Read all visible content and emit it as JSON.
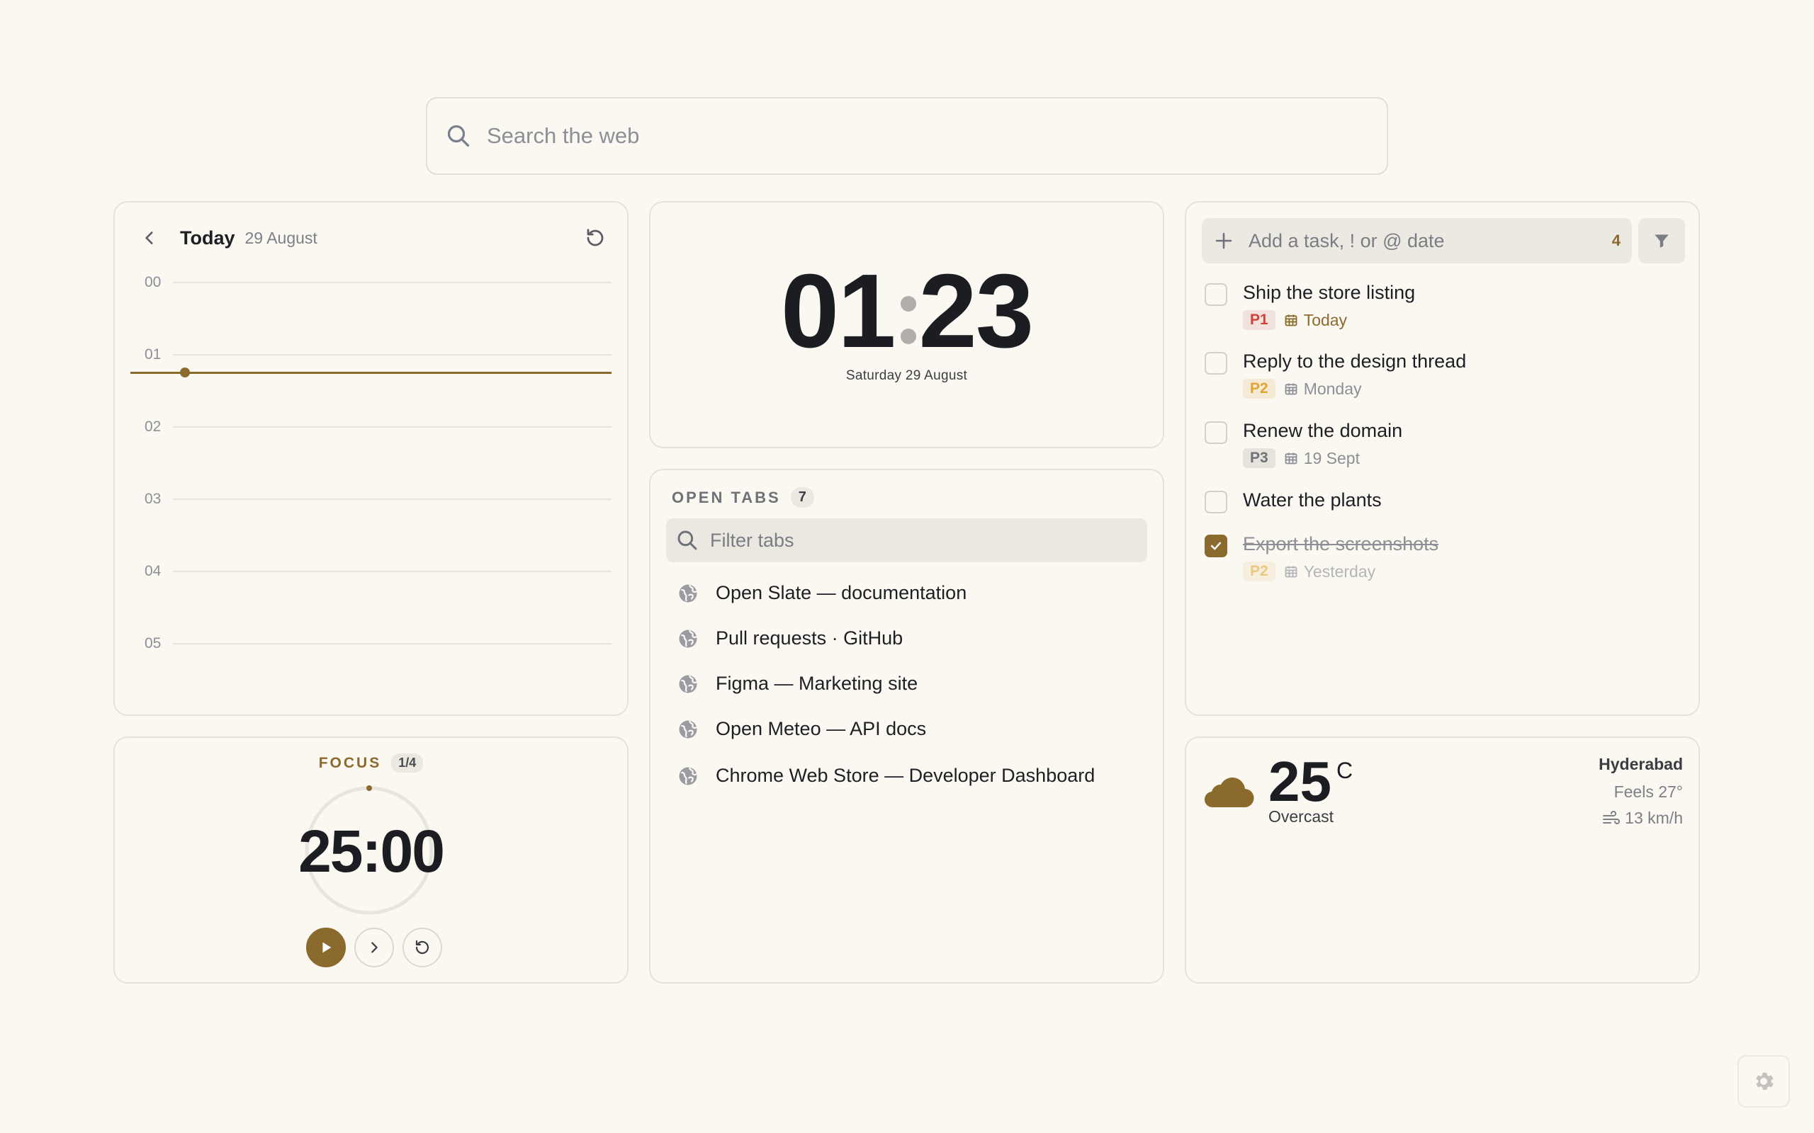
{
  "search": {
    "placeholder": "Search the web"
  },
  "calendar": {
    "title": "Today",
    "date": "29 August",
    "hours": [
      "00",
      "01",
      "02",
      "03",
      "04",
      "05"
    ]
  },
  "clock": {
    "hours": "01",
    "minutes": "23",
    "date": "Saturday 29 August"
  },
  "tasks": {
    "add_placeholder": "Add a task, ! or @ date",
    "count": "4",
    "items": [
      {
        "title": "Ship the store listing",
        "priority": "P1",
        "due": "Today",
        "done": false
      },
      {
        "title": "Reply to the design thread",
        "priority": "P2",
        "due": "Monday",
        "done": false
      },
      {
        "title": "Renew the domain",
        "priority": "P3",
        "due": "19 Sept",
        "done": false
      },
      {
        "title": "Water the plants",
        "priority": "",
        "due": "",
        "done": false
      },
      {
        "title": "Export the screenshots",
        "priority": "P2",
        "due": "Yesterday",
        "done": true
      }
    ]
  },
  "focus": {
    "label": "FOCUS",
    "session": "1/4",
    "time": "25:00",
    "progress": 0
  },
  "tabs": {
    "label": "OPEN TABS",
    "count": "7",
    "filter_placeholder": "Filter tabs",
    "items": [
      "Open Slate — documentation",
      "Pull requests · GitHub",
      "Figma — Marketing site",
      "Open Meteo — API docs",
      "Chrome Web Store — Developer Dashboard"
    ]
  },
  "weather": {
    "temp": "25",
    "unit": "C",
    "condition": "Overcast",
    "city": "Hyderabad",
    "feels": "Feels 27°",
    "wind": "13 km/h"
  },
  "colors": {
    "accent": "#8b6a2e",
    "background": "#fbf8f2",
    "p1": "#d1403c",
    "p2": "#e3a42e",
    "p3": "#6f7178"
  }
}
